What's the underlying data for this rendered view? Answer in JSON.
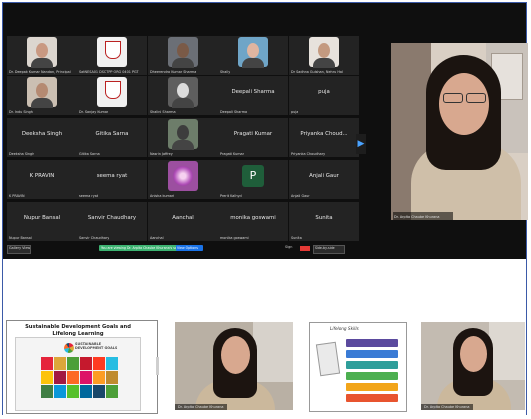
{
  "gallery": {
    "tiles": [
      {
        "name": "",
        "label": "Dr. Deepak Kumar Nandan, Principal"
      },
      {
        "name": "",
        "label": "SatNESA01 DSCTPP ORG 0401 PGT"
      },
      {
        "name": "",
        "label": "Dheerendra Kumar Sharma"
      },
      {
        "name": "",
        "label": "Shaily"
      },
      {
        "name": "",
        "label": "Dr Sadhna Gulshan, Nehru Hal"
      },
      {
        "name": "",
        "label": "Dr. Indu Singh"
      },
      {
        "name": "",
        "label": "Dr. Sanjay Kumar"
      },
      {
        "name": "",
        "label": "Shalini Sharma"
      },
      {
        "name": "Deepali Sharma",
        "label": "Deepali Sharma"
      },
      {
        "name": "puja",
        "label": "puja"
      },
      {
        "name": "Deeksha Singh",
        "label": "Deeksha Singh"
      },
      {
        "name": "Gitika Sarna",
        "label": "Gitika Sarna"
      },
      {
        "name": "",
        "label": "Nasrin Jaffrey"
      },
      {
        "name": "Pragati Kumar",
        "label": "Pragati Kumar"
      },
      {
        "name": "Priyanka Choud...",
        "label": "Priyanka Choudhary"
      },
      {
        "name": "K PRAVIN",
        "label": "K PRAVIN"
      },
      {
        "name": "seema ryat",
        "label": "seema ryat"
      },
      {
        "name": "",
        "label": "Anisha kumari"
      },
      {
        "name": "P",
        "label": "Prerit Kalhyd"
      },
      {
        "name": "Anjali Gaur",
        "label": "Anjali Gaur"
      },
      {
        "name": "Nupur Bansal",
        "label": "Nupur Bansal"
      },
      {
        "name": "Sanvir Chaudhary",
        "label": "Sanvir Chaudhary"
      },
      {
        "name": "Aanchal",
        "label": "Aanchal"
      },
      {
        "name": "monika goswami",
        "label": "monika goswami"
      },
      {
        "name": "Sunita",
        "label": "Sunita"
      }
    ]
  },
  "speaker": {
    "label": "Dr. Arpita Chaube Khurana"
  },
  "toolbar": {
    "view_label": "Gallery View",
    "share_banner": "You are viewing Dr. Arpita Chaube Khurana's screen",
    "view_options": "View Options",
    "sign_label": "Sign",
    "rec_label": "",
    "layout_label": "Side-by-side"
  },
  "bottom": {
    "slide1_title": "Sustainable Development Goals and Lifelong Learning",
    "slide1_logo": "SUSTAINABLE DEVELOPMENT GOALS",
    "cam1_label": "Dr. Arpita Chaube Khurana",
    "slide2_title": "Lifelong Skills",
    "cam2_label": "Dr. Arpita Chaube Khurana"
  },
  "colors": {
    "accent": "#2d8cff",
    "zoom_green": "#43a047",
    "banner_green": "#3cb371",
    "frame": "#3b5aa8"
  }
}
